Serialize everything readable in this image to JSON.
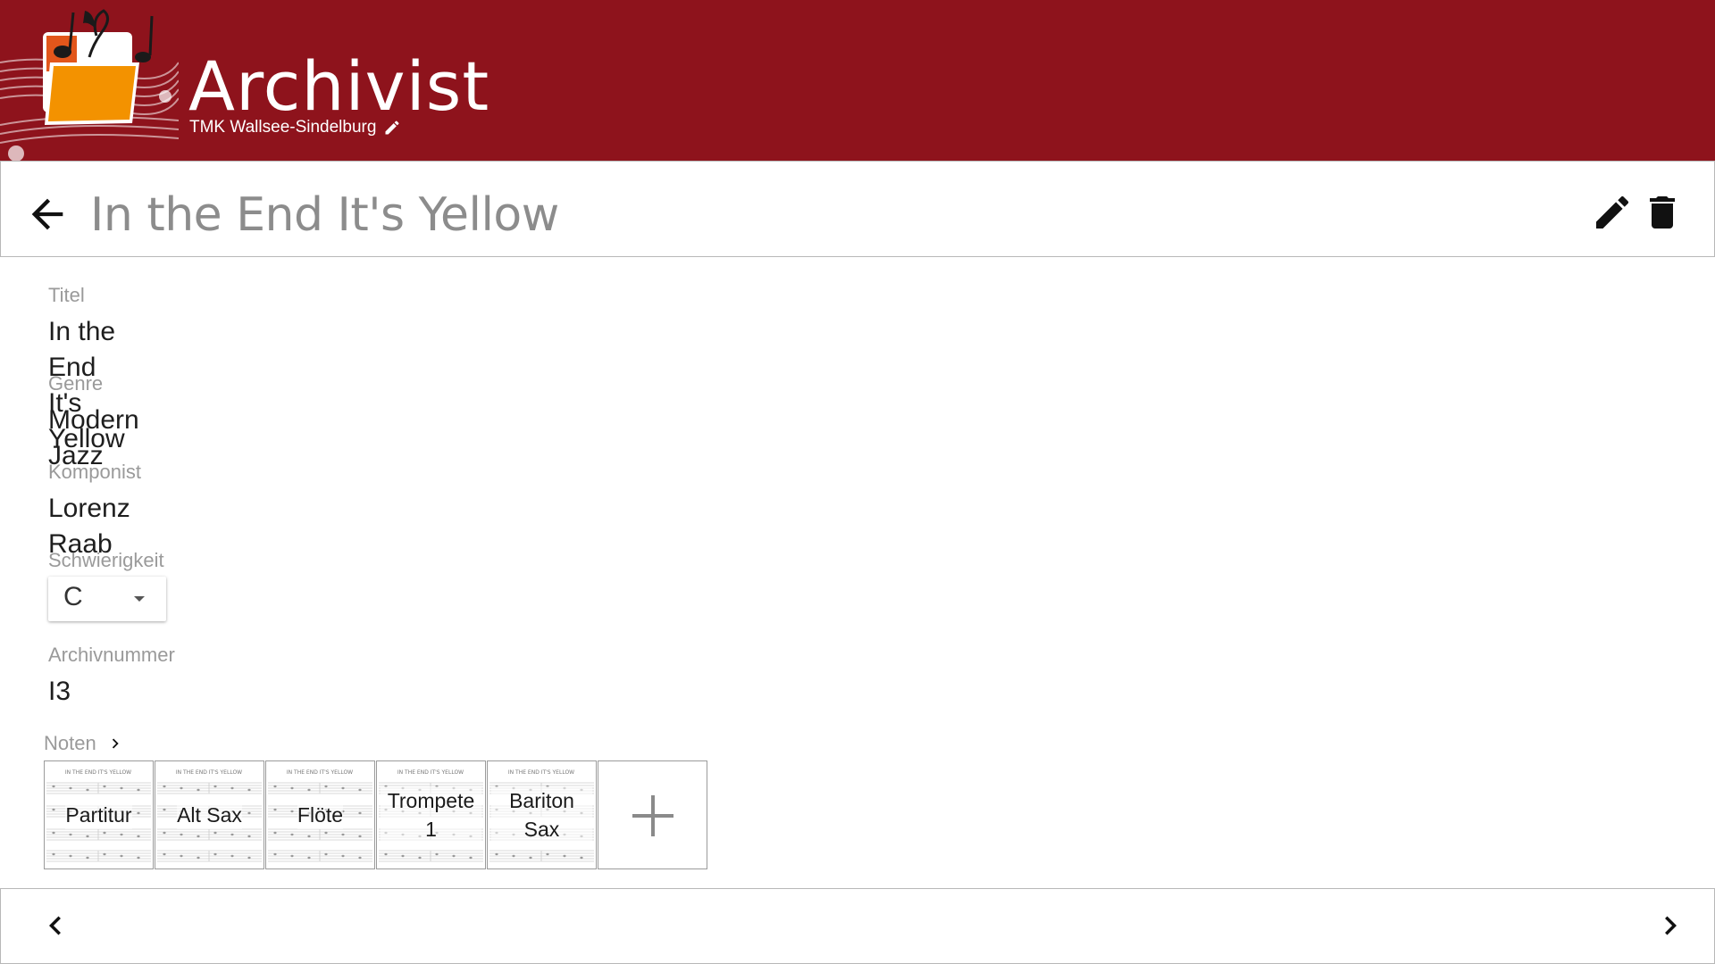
{
  "app": {
    "title": "Archivist",
    "organization": "TMK Wallsee-Sindelburg",
    "brand_color": "#8e131c",
    "logo_icon": "music-folder-logo"
  },
  "toolbar": {
    "page_title": "In the End It's Yellow",
    "back_icon": "arrow-left-icon",
    "edit_icon": "pencil-icon",
    "delete_icon": "trash-icon"
  },
  "fields": {
    "title": {
      "label": "Titel",
      "value": "In the End It's Yellow"
    },
    "genre": {
      "label": "Genre",
      "value": "Modern Jazz"
    },
    "composer": {
      "label": "Komponist",
      "value": "Lorenz Raab"
    },
    "difficulty": {
      "label": "Schwierigkeit",
      "value": "C"
    },
    "archive_number": {
      "label": "Archivnummer",
      "value": "I3"
    }
  },
  "noten": {
    "label": "Noten",
    "sheets": [
      {
        "name": "Partitur"
      },
      {
        "name": "Alt Sax"
      },
      {
        "name": "Flöte"
      },
      {
        "name": "Trompete 1"
      },
      {
        "name": "Bariton Sax"
      }
    ],
    "add_icon": "plus-icon"
  },
  "footer": {
    "prev_icon": "chevron-left-icon",
    "next_icon": "chevron-right-icon"
  }
}
